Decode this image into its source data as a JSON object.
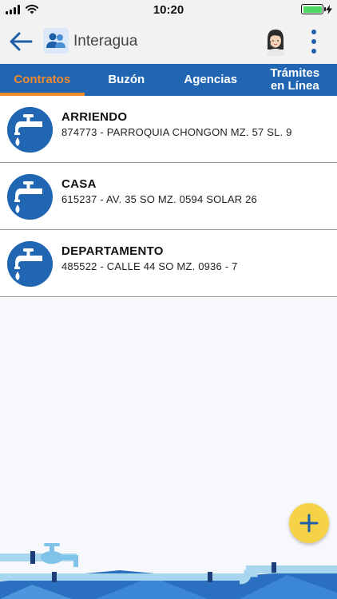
{
  "status_bar": {
    "time": "10:20",
    "battery_level": 1.0,
    "charging": true
  },
  "app_bar": {
    "title": "Interagua",
    "back_icon": "arrow-left-icon",
    "logo_icon": "users-icon",
    "avatar_icon": "support-agent-avatar",
    "menu_icon": "more-vertical-icon"
  },
  "tabs": [
    {
      "label": "Contratos",
      "active": true
    },
    {
      "label": "Buzón",
      "active": false
    },
    {
      "label": "Agencias",
      "active": false
    },
    {
      "label": "Trámites\nen Línea",
      "active": false
    }
  ],
  "contracts": [
    {
      "name": "ARRIENDO",
      "detail": "874773 - PARROQUIA CHONGON MZ. 57 SL. 9",
      "icon": "water-tap-icon"
    },
    {
      "name": "CASA",
      "detail": "615237 - AV. 35 SO MZ. 0594 SOLAR 26",
      "icon": "water-tap-icon"
    },
    {
      "name": "DEPARTAMENTO",
      "detail": "485522 - CALLE 44 SO MZ. 0936 - 7",
      "icon": "water-tap-icon"
    }
  ],
  "fab": {
    "icon": "plus-icon"
  },
  "colors": {
    "primary": "#2166b3",
    "accent_tab": "#f08a2e",
    "fab": "#f6d247",
    "battery": "#4cd964"
  }
}
